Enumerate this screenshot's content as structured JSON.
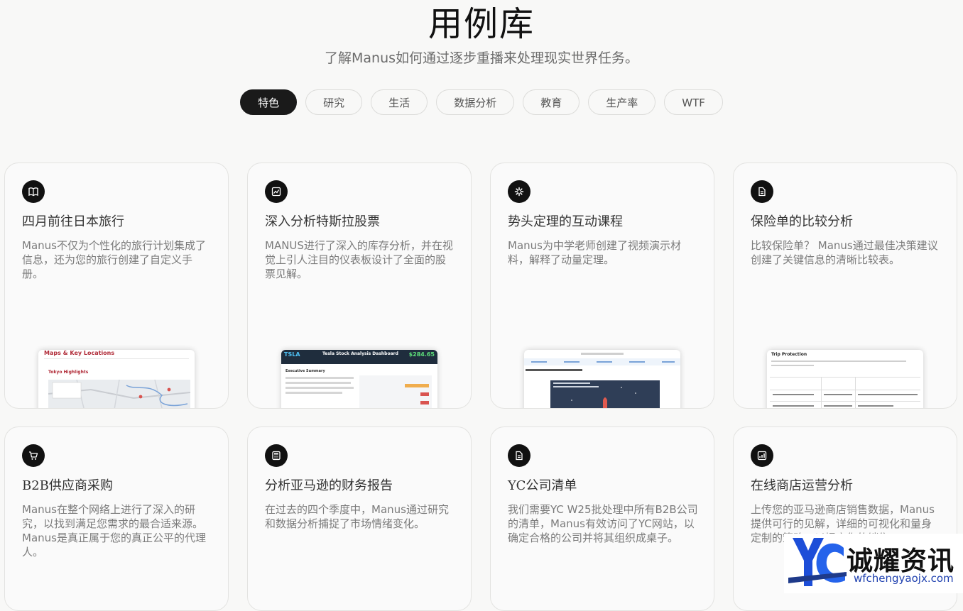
{
  "header": {
    "title": "用例库",
    "subtitle": "了解Manus如何通过逐步重播来处理现实世界任务。"
  },
  "tabs": [
    {
      "label": "特色",
      "active": true
    },
    {
      "label": "研究",
      "active": false
    },
    {
      "label": "生活",
      "active": false
    },
    {
      "label": "数据分析",
      "active": false
    },
    {
      "label": "教育",
      "active": false
    },
    {
      "label": "生产率",
      "active": false
    },
    {
      "label": "WTF",
      "active": false
    }
  ],
  "cards": [
    {
      "icon": "book-icon",
      "title": "四月前往日本旅行",
      "desc": "Manus不仅为个性化的旅行计划集成了信息，还为您的旅行创建了自定义手册。"
    },
    {
      "icon": "chart-icon",
      "title": "深入分析特斯拉股票",
      "desc": "MANUS进行了深入的库存分析，并在视觉上引人注目的仪表板设计了全面的股票见解。"
    },
    {
      "icon": "sparkle-icon",
      "title": "势头定理的互动课程",
      "desc": "Manus为中学老师创建了视频演示材料，解释了动量定理。"
    },
    {
      "icon": "document-icon",
      "title": "保险单的比较分析",
      "desc": "比较保险单？ Manus通过最佳决策建议创建了关键信息的清晰比较表。"
    },
    {
      "icon": "cart-icon",
      "title": "B2B供应商采购",
      "desc": "Manus在整个网络上进行了深入的研究，以找到满足您需求的最合适来源。 Manus是真正属于您的真正公平的代理人。"
    },
    {
      "icon": "calculator-icon",
      "title": "分析亚马逊的财务报告",
      "desc": "在过去的四个季度中，Manus通过研究和数据分析捕捉了市场情绪变化。"
    },
    {
      "icon": "document-icon",
      "title": "YC公司清单",
      "desc": "我们需要YC W25批处理中所有B2B公司的清单，Manus有效访问了YC网站，以确定合格的公司并将其组织成桌子。"
    },
    {
      "icon": "analytics-icon",
      "title": "在线商店运营分析",
      "desc": "上传您的亚马逊商店销售数据，Manus提供可行的见解，详细的可视化和量身定制的策略，以提高您的销售。"
    }
  ],
  "thumbs": {
    "japan": {
      "heading": "Maps & Key Locations",
      "sub": "Tokyo Highlights"
    },
    "tesla": {
      "ticker": "TSLA",
      "heading": "Tesla Stock Analysis Dashboard",
      "price": "$284.65",
      "section": "Executive Summary"
    },
    "insurance": {
      "heading": "Trip Protection"
    }
  },
  "watermark": {
    "name": "诚耀资讯",
    "url": "wfchengyaojx.com"
  }
}
